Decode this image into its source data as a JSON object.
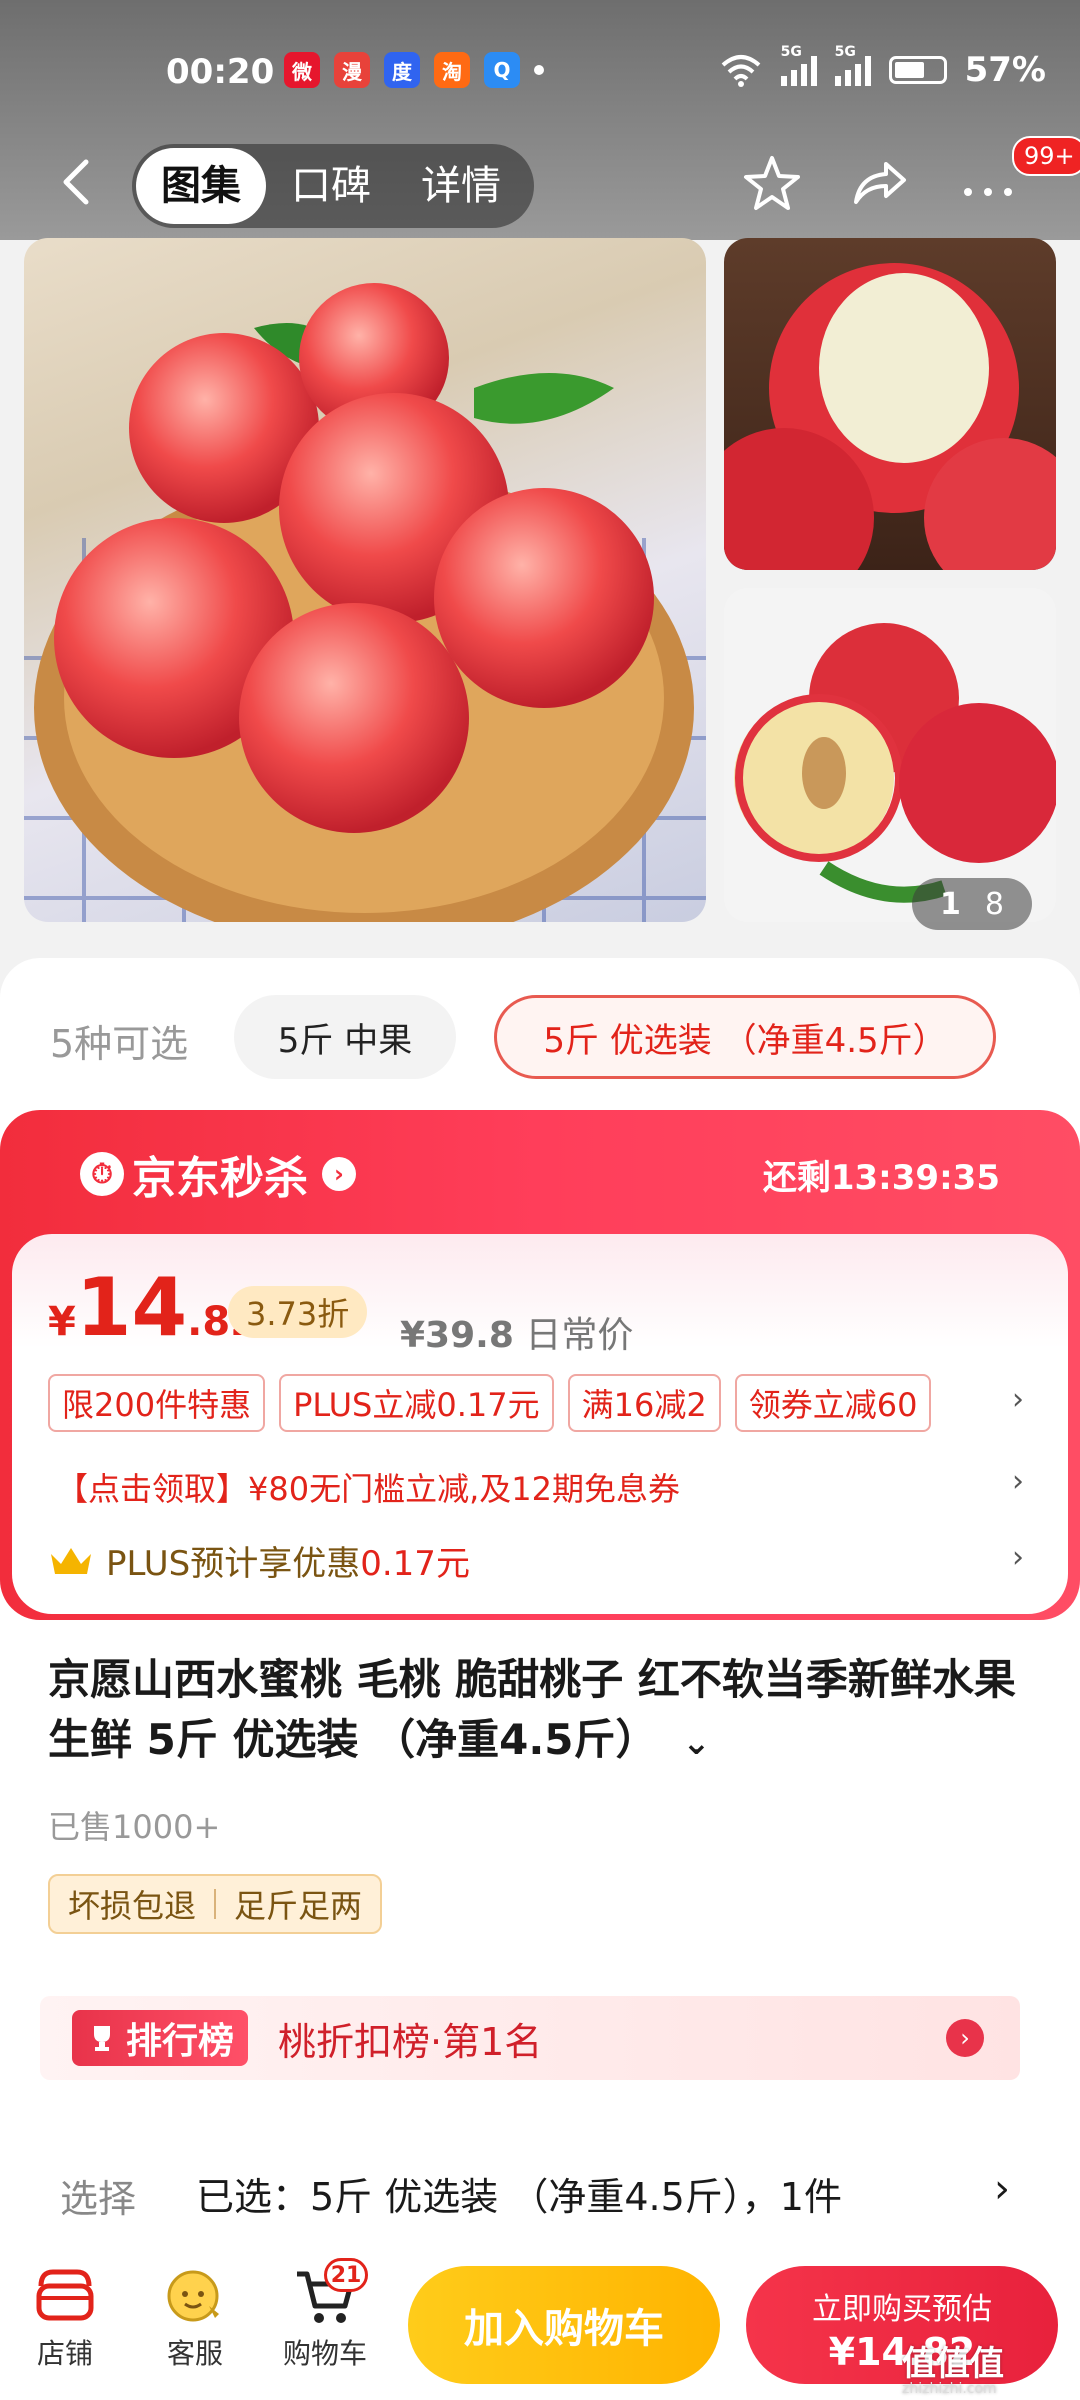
{
  "status_bar": {
    "time": "00:20",
    "network1": "5G",
    "network2": "5G",
    "battery": "57%",
    "battery_level": 0.57
  },
  "nav": {
    "tabs": [
      "图集",
      "口碑",
      "详情"
    ],
    "active_tab": "图集",
    "more_badge": "99+"
  },
  "gallery": {
    "pager_current": "1",
    "pager_total": "8"
  },
  "variants": {
    "count_label": "5种可选",
    "options": [
      "5斤 中果",
      "5斤 优选装 （净重4.5斤）"
    ],
    "selected": "5斤 优选装 （净重4.5斤）"
  },
  "seckill": {
    "label": "京东秒杀",
    "countdown": "还剩13:39:35"
  },
  "price": {
    "symbol": "¥",
    "integer": "14",
    "decimal": ".82",
    "discount": "3.73折",
    "original": "¥39.8",
    "original_label": "日常价"
  },
  "promo_tags": [
    "限200件特惠",
    "PLUS立减0.17元",
    "满16减2",
    "领券立减60"
  ],
  "coupon_text": "【点击领取】¥80无门槛立减,及12期免息券",
  "plus": {
    "prefix": "PLUS预计享优惠",
    "amount": "0.17元"
  },
  "product": {
    "title": "京愿山西水蜜桃 毛桃 脆甜桃子 红不软当季新鲜水果生鲜 5斤 优选装 （净重4.5斤）",
    "sold": "已售1000+",
    "services": [
      "坏损包退",
      "足斤足两"
    ]
  },
  "ranking": {
    "badge": "排行榜",
    "text": "桃折扣榜·第1名"
  },
  "select_row": {
    "label": "选择",
    "value": "已选：5斤 优选装 （净重4.5斤），1件"
  },
  "bottom_bar": {
    "shop": "店铺",
    "service": "客服",
    "cart": "购物车",
    "cart_count": "21",
    "add_cart": "加入购物车",
    "buy_line1": "立即购买预估",
    "buy_line2": "¥14.82"
  },
  "watermark": "值值值",
  "watermark_sub": "zhizhizhi.com",
  "colors": {
    "brand_red": "#e2231a",
    "seckill_red": "#f22d3c",
    "cart_yellow": "#ffc400"
  }
}
